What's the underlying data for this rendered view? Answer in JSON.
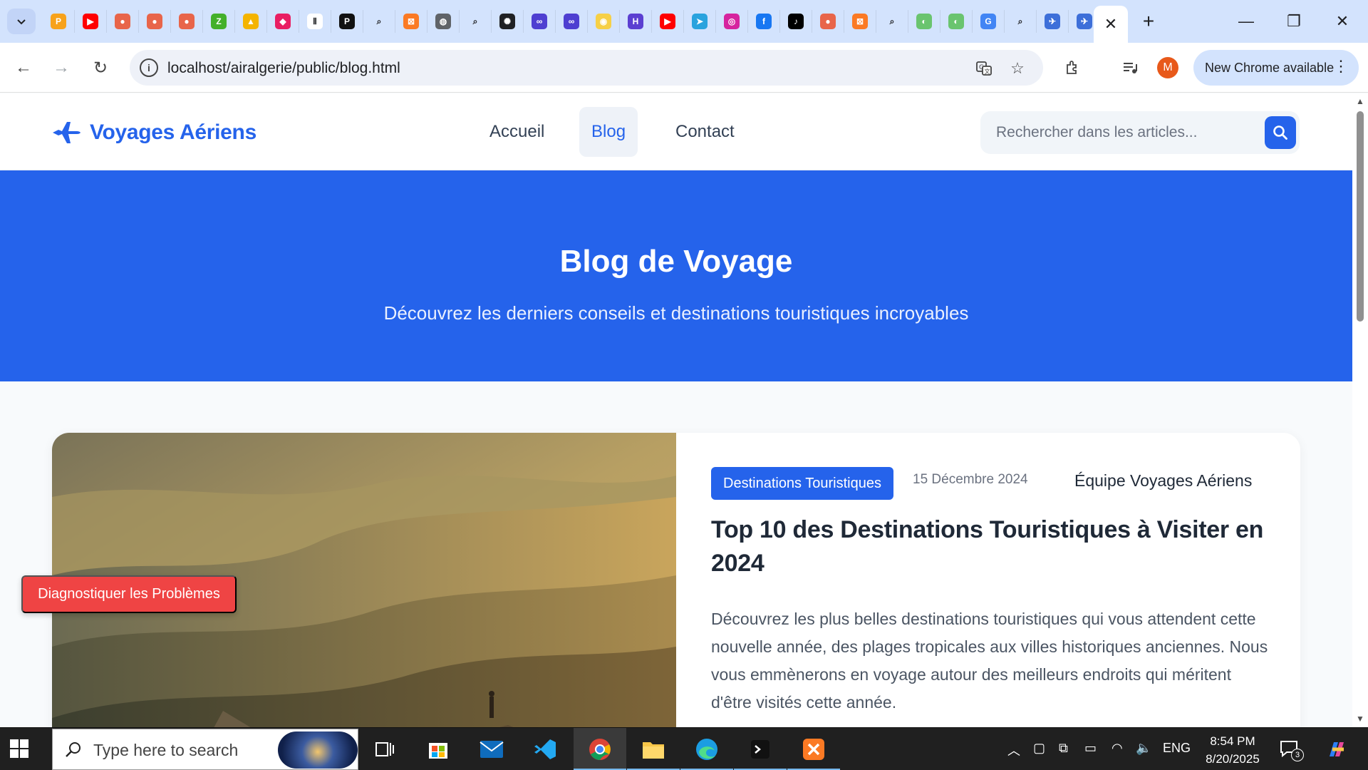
{
  "browser": {
    "favicons": [
      {
        "name": "phpmyadmin-icon",
        "color": "#f7a21b",
        "glyph": "P"
      },
      {
        "name": "youtube-icon",
        "color": "#ff0000",
        "glyph": "▶"
      },
      {
        "name": "claude-icon",
        "color": "#e8654a",
        "glyph": "●"
      },
      {
        "name": "claude-icon",
        "color": "#e8654a",
        "glyph": "●"
      },
      {
        "name": "claude-icon",
        "color": "#e8654a",
        "glyph": "●"
      },
      {
        "name": "green-app-icon",
        "color": "#43b02a",
        "glyph": "Z"
      },
      {
        "name": "course-icon",
        "color": "#f4b400",
        "glyph": "▲"
      },
      {
        "name": "pink-drop-icon",
        "color": "#e91e63",
        "glyph": "◆"
      },
      {
        "name": "pause-icon",
        "color": "#ffffff",
        "glyph": "Ⅱ"
      },
      {
        "name": "perplexity-icon",
        "color": "#111111",
        "glyph": "P"
      },
      {
        "name": "search-tab-icon",
        "color": "#d3e3fd",
        "glyph": "⌕"
      },
      {
        "name": "xampp-icon",
        "color": "#fb7a24",
        "glyph": "⊠"
      },
      {
        "name": "globe-icon",
        "color": "#5f6368",
        "glyph": "◍"
      },
      {
        "name": "search-tab-icon",
        "color": "#d3e3fd",
        "glyph": "⌕"
      },
      {
        "name": "openai-icon",
        "color": "#202124",
        "glyph": "✺"
      },
      {
        "name": "meta-icon",
        "color": "#4e3fd1",
        "glyph": "∞"
      },
      {
        "name": "meta-icon",
        "color": "#4e3fd1",
        "glyph": "∞"
      },
      {
        "name": "yellow-app-icon",
        "color": "#f6d047",
        "glyph": "◉"
      },
      {
        "name": "purple-app-icon",
        "color": "#5b3fd1",
        "glyph": "H"
      },
      {
        "name": "youtube-icon",
        "color": "#ff0000",
        "glyph": "▶"
      },
      {
        "name": "telegram-icon",
        "color": "#2aa3de",
        "glyph": "➤"
      },
      {
        "name": "instagram-icon",
        "color": "#d6249f",
        "glyph": "◎"
      },
      {
        "name": "facebook-icon",
        "color": "#1877f2",
        "glyph": "f"
      },
      {
        "name": "tiktok-icon",
        "color": "#000000",
        "glyph": "♪"
      },
      {
        "name": "claude-icon",
        "color": "#e8654a",
        "glyph": "●"
      },
      {
        "name": "xampp-icon",
        "color": "#fb7a24",
        "glyph": "⊠"
      },
      {
        "name": "search-tab-icon",
        "color": "#d3e3fd",
        "glyph": "⌕"
      },
      {
        "name": "copilot-icon",
        "color": "#6ac46f",
        "glyph": "◐"
      },
      {
        "name": "copilot-icon",
        "color": "#6ac46f",
        "glyph": "◐"
      },
      {
        "name": "google-alert-icon",
        "color": "#4285f4",
        "glyph": "G"
      },
      {
        "name": "search-tab-icon",
        "color": "#d3e3fd",
        "glyph": "⌕"
      },
      {
        "name": "bird-icon",
        "color": "#3d6fd9",
        "glyph": "✈"
      },
      {
        "name": "bird-icon",
        "color": "#3d6fd9",
        "glyph": "✈"
      }
    ],
    "url": "localhost/airalgerie/public/blog.html",
    "avatar_letter": "M",
    "new_chrome_label": "New Chrome available"
  },
  "site": {
    "brand": "Voyages Aériens",
    "nav": {
      "home": "Accueil",
      "blog": "Blog",
      "contact": "Contact"
    },
    "search_placeholder": "Rechercher dans les articles...",
    "colors": {
      "primary": "#2563eb",
      "danger": "#ef4444"
    }
  },
  "hero": {
    "title": "Blog de Voyage",
    "subtitle": "Découvrez les derniers conseils et destinations touristiques incroyables"
  },
  "article": {
    "category": "Destinations Touristiques",
    "date": "15 Décembre 2024",
    "author": "Équipe Voyages Aériens",
    "title": "Top 10 des Destinations Touristiques à Visiter en 2024",
    "excerpt": "Découvrez les plus belles destinations touristiques qui vous attendent cette nouvelle année, des plages tropicales aux villes historiques anciennes. Nous vous emmènerons en voyage autour des meilleurs endroits qui méritent d'être visités cette année."
  },
  "diagnose_button": "Diagnostiquer les Problèmes",
  "taskbar": {
    "search_placeholder": "Type here to search",
    "language": "ENG",
    "time": "8:54 PM",
    "date": "8/20/2025",
    "notification_count": "3"
  }
}
